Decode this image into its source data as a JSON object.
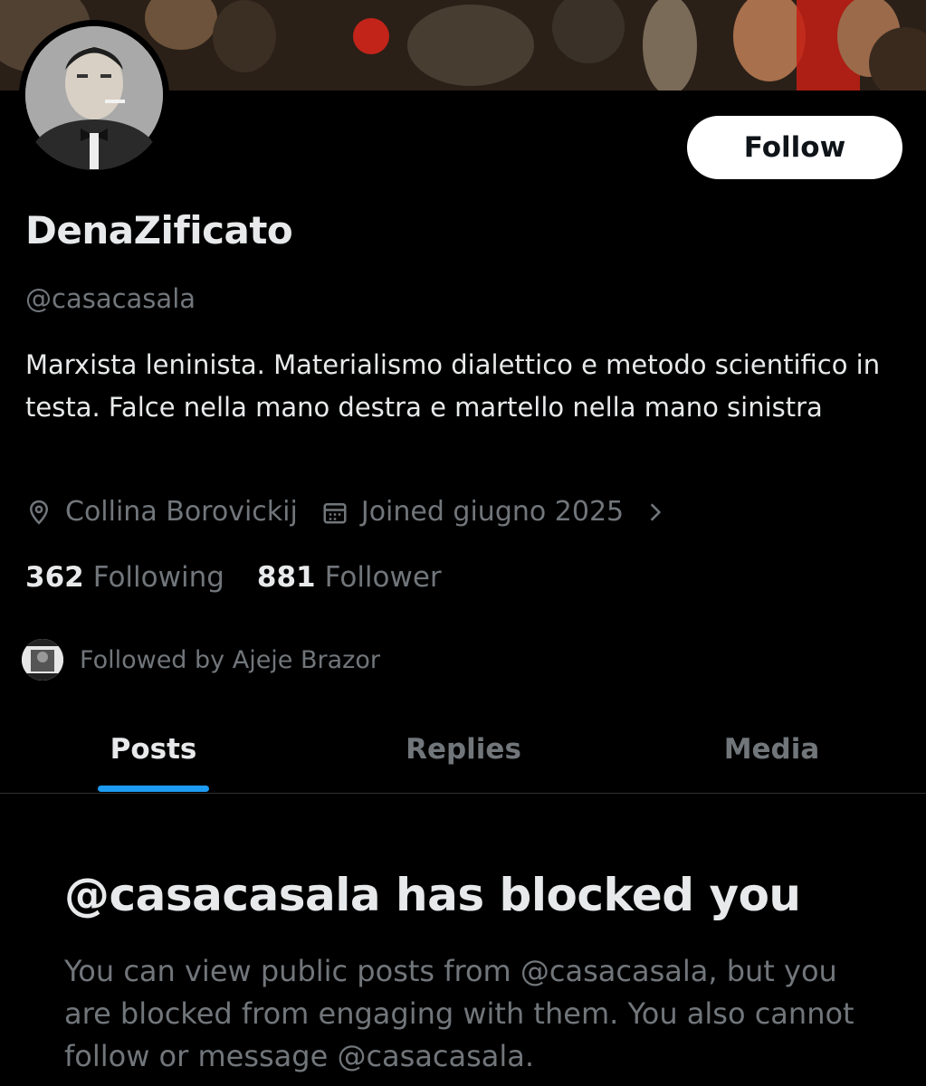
{
  "profile": {
    "display_name": "DenaZificato",
    "handle": "@casacasala",
    "bio": "Marxista leninista. Materialismo dialettico e metodo scientifico in testa. Falce nella mano destra e martello nella mano sinistra",
    "location": "Collina Borovickij",
    "joined": "Joined giugno 2025",
    "following_count": "362",
    "following_label": "Following",
    "followers_count": "881",
    "followers_label": "Follower",
    "followed_by": "Followed by Ajeje Brazor"
  },
  "actions": {
    "follow_label": "Follow"
  },
  "tabs": [
    {
      "label": "Posts",
      "active": true
    },
    {
      "label": "Replies",
      "active": false
    },
    {
      "label": "Media",
      "active": false
    }
  ],
  "blocked": {
    "title": "@casacasala has blocked you",
    "description": "You can view public posts from @casacasala, but you are blocked from engaging with them. You also cannot follow or message @casacasala."
  },
  "icons": {
    "location": "location-pin-icon",
    "calendar": "calendar-icon",
    "chevron": "chevron-right-icon"
  },
  "colors": {
    "background": "#000000",
    "primary_text": "#e7e9ea",
    "secondary_text": "#71767b",
    "accent": "#1d9bf0",
    "follow_button_bg": "#ffffff"
  }
}
